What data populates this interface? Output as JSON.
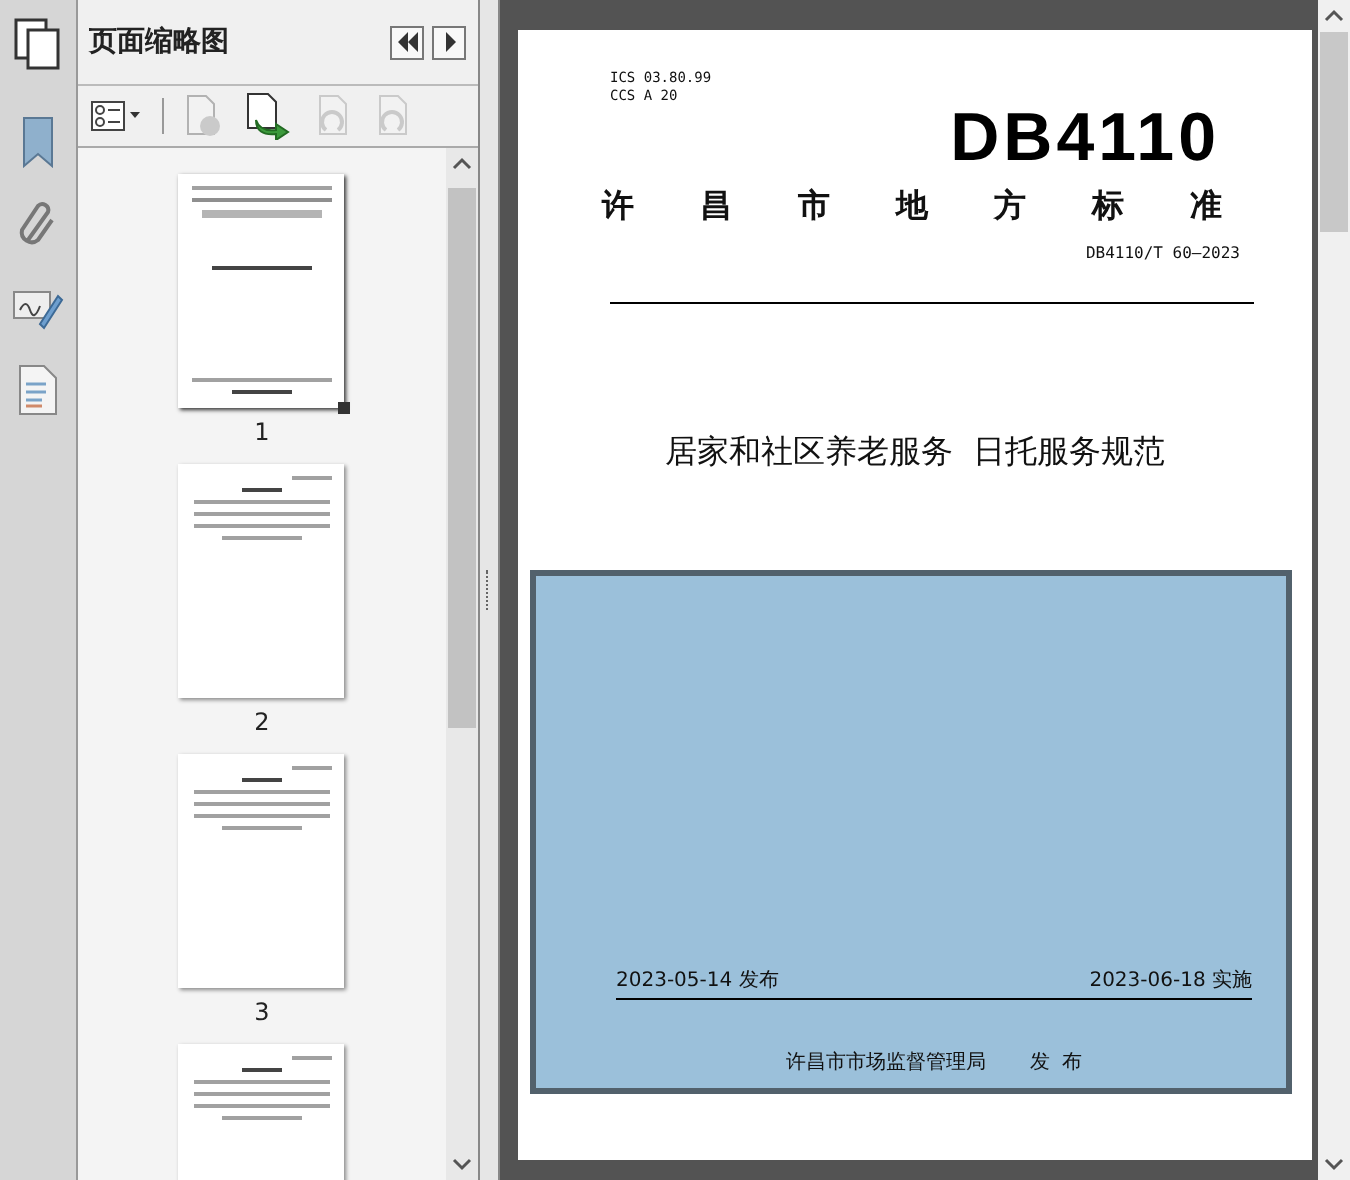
{
  "panel": {
    "title": "页面缩略图"
  },
  "thumbnails": [
    {
      "label": "1",
      "selected": true
    },
    {
      "label": "2",
      "selected": false
    },
    {
      "label": "3",
      "selected": false
    },
    {
      "selected": false
    }
  ],
  "page": {
    "ics": "ICS  03.80.99",
    "ccs": "CCS  A 20",
    "logo": "DB4110",
    "authority": "许昌市地方标准",
    "standard_no": "DB4110/T 60—2023",
    "title": "居家和社区养老服务  日托服务规范",
    "publish_date": "2023-05-14 发布",
    "effective_date": "2023-06-18 实施",
    "issuer": "许昌市市场监督管理局",
    "issuer_action": "发  布"
  }
}
